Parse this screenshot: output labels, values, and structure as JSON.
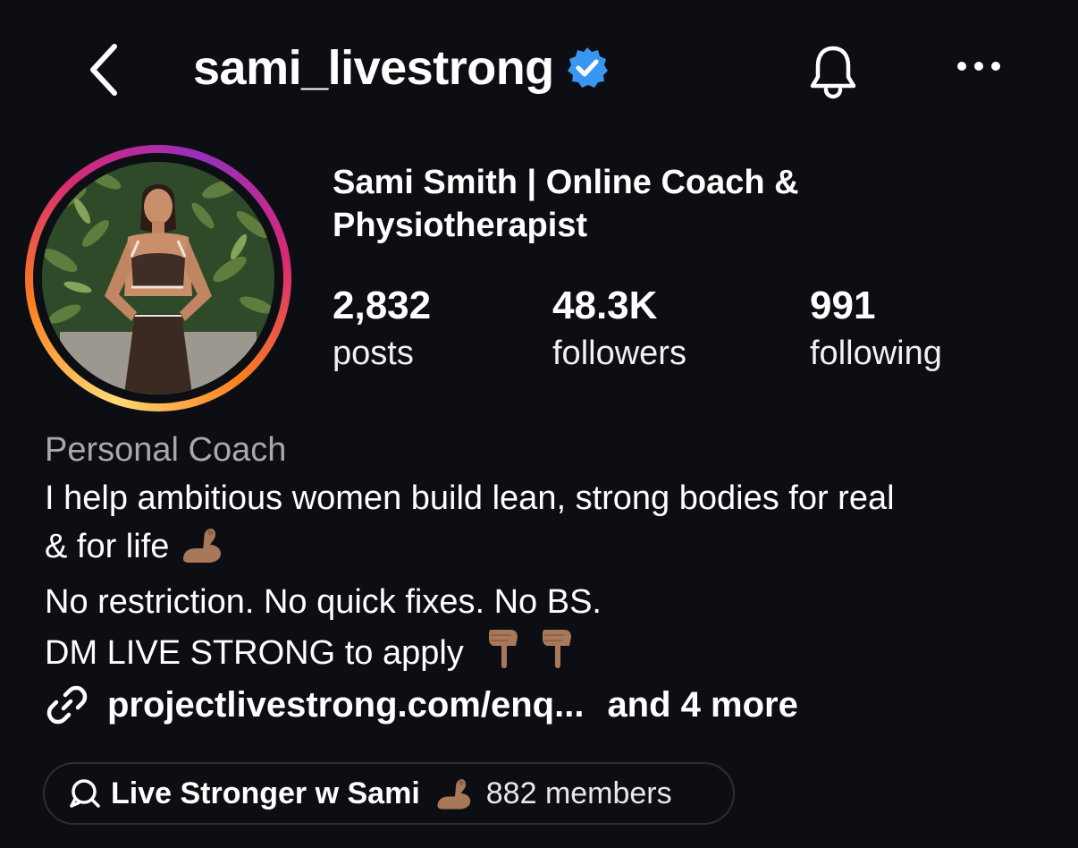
{
  "header": {
    "back_icon": "chevron-left-icon",
    "username": "sami_livestrong",
    "verified_icon": "verified-badge-icon",
    "verified_color": "#3897f0",
    "notification_icon": "bell-icon",
    "more_icon": "ellipsis-icon"
  },
  "profile": {
    "display_name": "Sami Smith | Online Coach & Physiotherapist",
    "story_ring_colors": [
      "#feda75",
      "#fa7e1e",
      "#d62976",
      "#962fbf"
    ]
  },
  "stats": [
    {
      "value": "2,832",
      "label": "posts"
    },
    {
      "value": "48.3K",
      "label": "followers"
    },
    {
      "value": "991",
      "label": "following"
    }
  ],
  "bio": {
    "category": "Personal Coach",
    "lines": [
      "I help ambitious women build lean, strong bodies for real",
      "& for life",
      "No restriction. No quick fixes. No BS.",
      "DM LIVE STRONG to apply"
    ],
    "emoji_muscle": "flexed-biceps-emoji",
    "emoji_pointing": "pointing-down-emoji"
  },
  "links": {
    "icon": "link-icon",
    "primary": "projectlivestrong.com/enq...",
    "more": "and 4 more"
  },
  "channel": {
    "icon": "broadcast-channel-icon",
    "name": "Live Stronger w Sami",
    "members": "882 members"
  }
}
